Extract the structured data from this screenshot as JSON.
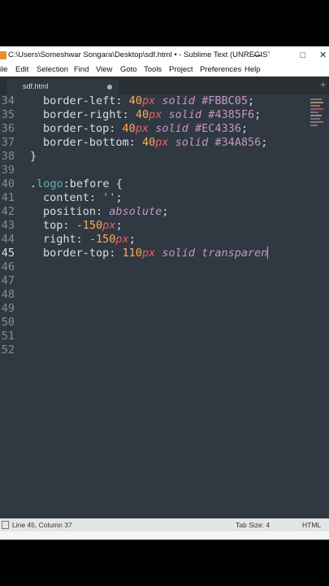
{
  "window": {
    "title": "C:\\Users\\Someshwar Songara\\Desktop\\sdf.html • - Sublime Text (UNREGISTER...",
    "minimize": "—",
    "maximize": "□",
    "close": "✕"
  },
  "menu": [
    "ile",
    "Edit",
    "Selection",
    "Find",
    "View",
    "Goto",
    "Tools",
    "Project",
    "Preferences",
    "Help"
  ],
  "tab": {
    "label": "sdf.html",
    "new_tab": "+"
  },
  "gutter": [
    "34",
    "35",
    "36",
    "37",
    "38",
    "39",
    "40",
    "41",
    "42",
    "43",
    "44",
    "45",
    "46",
    "47",
    "48",
    "49",
    "50",
    "51",
    "52"
  ],
  "current_line": "45",
  "code": {
    "l34": [
      "border-left",
      ": ",
      "40",
      "px",
      " solid ",
      "#FBBC05",
      ";"
    ],
    "l35": [
      "border-right",
      ": ",
      "40",
      "px",
      " solid ",
      "#4385F6",
      ";"
    ],
    "l36": [
      "border-top",
      ": ",
      "40",
      "px",
      " solid ",
      "#EC4336",
      ";"
    ],
    "l37": [
      "border-bottom",
      ": ",
      "40",
      "px",
      " solid ",
      "#34A856",
      ";"
    ],
    "l38": "}",
    "l40": [
      ".",
      "logo",
      ":",
      "before",
      " {"
    ],
    "l41": [
      "content",
      ": ",
      "''",
      ";"
    ],
    "l42": [
      "position",
      ": ",
      "absolute",
      ";"
    ],
    "l43": [
      "top",
      ": ",
      "-150",
      "px",
      ";"
    ],
    "l44": [
      "right",
      ": ",
      "-150",
      "px",
      ";"
    ],
    "l45": [
      "border-top",
      ": ",
      "110",
      "px",
      " solid ",
      "transparen"
    ]
  },
  "status": {
    "position": "Line 45, Column 37",
    "tab_size": "Tab Size: 4",
    "syntax": "HTML"
  },
  "colors": {
    "editor_bg": "#303841",
    "number": "#f9ae58",
    "unit": "#ec5f66",
    "keyword": "#c695c6",
    "class": "#5fb4b4",
    "string": "#99c794"
  }
}
